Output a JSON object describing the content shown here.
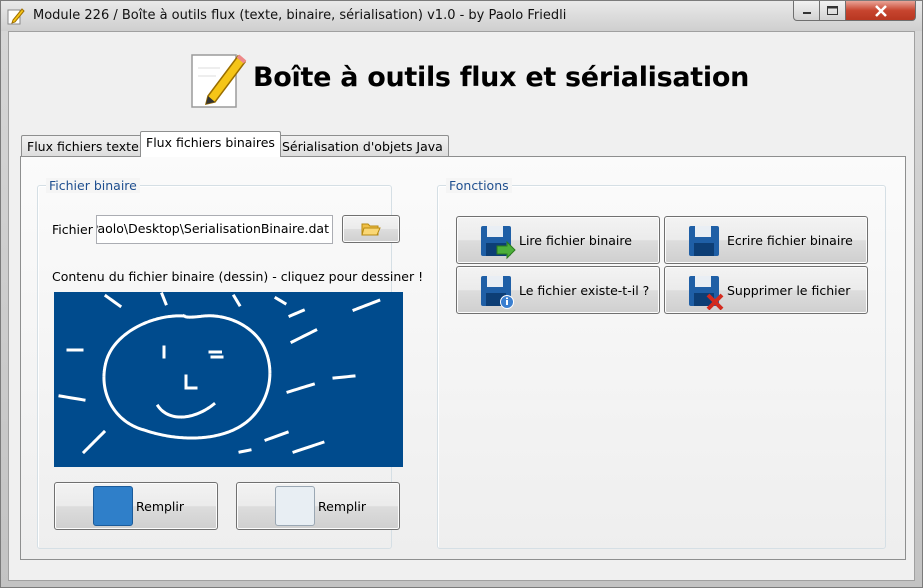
{
  "window": {
    "title": "Module 226 / Boîte à outils flux (texte, binaire, sérialisation) v1.0 - by Paolo Friedli"
  },
  "header": {
    "title": "Boîte à outils flux et sérialisation",
    "icon": "notepad-pencil-icon"
  },
  "tabs": [
    {
      "label": "Flux fichiers texte",
      "active": false
    },
    {
      "label": "Flux fichiers binaires",
      "active": true
    },
    {
      "label": "Sérialisation d'objets Java",
      "active": false
    }
  ],
  "binary_file": {
    "group_title": "Fichier binaire",
    "file_label": "Fichier",
    "file_value": "\\Paolo\\Desktop\\SerialisationBinaire.dat",
    "browse_icon": "folder-open-icon",
    "content_label": "Contenu du fichier binaire (dessin) - cliquez pour dessiner !",
    "canvas_color": "#004b8d",
    "fill_buttons": [
      {
        "label": "Remplir",
        "swatch": "#2f7fc9"
      },
      {
        "label": "Remplir",
        "swatch": "#e8eef3"
      }
    ]
  },
  "functions": {
    "group_title": "Fonctions",
    "buttons": [
      {
        "label": "Lire fichier binaire",
        "icon": "floppy-read-icon"
      },
      {
        "label": "Ecrire fichier binaire",
        "icon": "floppy-write-icon"
      },
      {
        "label": "Le fichier existe-t-il ?",
        "icon": "floppy-info-icon"
      },
      {
        "label": "Supprimer le fichier",
        "icon": "floppy-delete-icon"
      }
    ]
  }
}
